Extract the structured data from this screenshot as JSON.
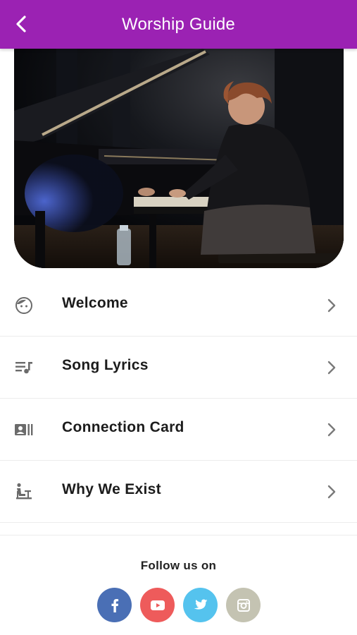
{
  "header": {
    "title": "Worship Guide",
    "background": "#9b22b3"
  },
  "menu": {
    "items": [
      {
        "label": "Welcome",
        "icon": "face-icon"
      },
      {
        "label": "Song Lyrics",
        "icon": "queue-music-icon"
      },
      {
        "label": "Connection Card",
        "icon": "contact-card-icon"
      },
      {
        "label": "Why We Exist",
        "icon": "person-at-desk-icon"
      }
    ]
  },
  "footer": {
    "follow_label": "Follow us on",
    "social": [
      {
        "name": "facebook",
        "icon": "facebook-icon",
        "color": "#4a6fb5"
      },
      {
        "name": "youtube",
        "icon": "youtube-icon",
        "color": "#ee5b5b"
      },
      {
        "name": "twitter",
        "icon": "twitter-icon",
        "color": "#55c3ee"
      },
      {
        "name": "instagram",
        "icon": "instagram-icon",
        "color": "#c4c3b2"
      }
    ]
  }
}
